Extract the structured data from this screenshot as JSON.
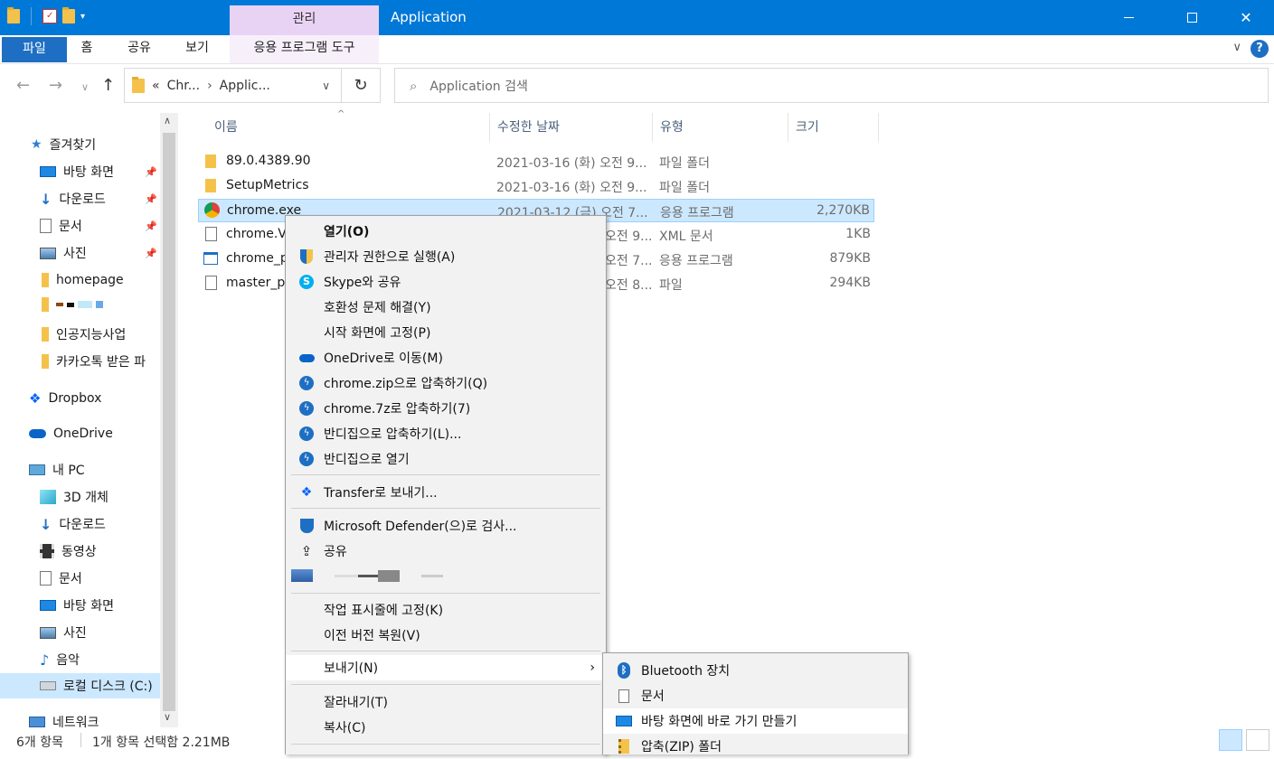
{
  "window": {
    "title": "Application",
    "context_tab_group": "관리",
    "buttons": {
      "minimize": "—",
      "maximize": "☐",
      "close": "✕"
    }
  },
  "ribbon": {
    "tabs": [
      "파일",
      "홈",
      "공유",
      "보기",
      "응용 프로그램 도구"
    ],
    "help": "?"
  },
  "address": {
    "prefix": "«",
    "crumb1": "Chr...",
    "crumb2": "Applic...",
    "search_placeholder": "Application 검색"
  },
  "sidebar": {
    "items": [
      {
        "label": "즐겨찾기",
        "icon": "star-icon"
      },
      {
        "label": "바탕 화면",
        "icon": "desktop-icon",
        "pinned": true
      },
      {
        "label": "다운로드",
        "icon": "download-icon",
        "pinned": true
      },
      {
        "label": "문서",
        "icon": "document-icon",
        "pinned": true
      },
      {
        "label": "사진",
        "icon": "pictures-icon",
        "pinned": true
      },
      {
        "label": "homepage",
        "icon": "folder-icon"
      },
      {
        "label": "",
        "icon": "folder-icon"
      },
      {
        "label": "인공지능사업",
        "icon": "folder-icon"
      },
      {
        "label": "카카오톡 받은 파",
        "icon": "folder-icon"
      },
      {
        "label": "Dropbox",
        "icon": "dropbox-icon"
      },
      {
        "label": "OneDrive",
        "icon": "onedrive-icon"
      },
      {
        "label": "내 PC",
        "icon": "pc-icon"
      },
      {
        "label": "3D 개체",
        "icon": "3d-objects-icon"
      },
      {
        "label": "다운로드",
        "icon": "download-icon"
      },
      {
        "label": "동영상",
        "icon": "video-icon"
      },
      {
        "label": "문서",
        "icon": "document-icon"
      },
      {
        "label": "바탕 화면",
        "icon": "desktop-icon"
      },
      {
        "label": "사진",
        "icon": "pictures-icon"
      },
      {
        "label": "음악",
        "icon": "music-icon"
      },
      {
        "label": "로컬 디스크 (C:)",
        "icon": "drive-icon"
      },
      {
        "label": "네트워크",
        "icon": "network-icon"
      }
    ]
  },
  "columns": {
    "name": "이름",
    "date": "수정한 날짜",
    "type": "유형",
    "size": "크기"
  },
  "files": [
    {
      "name": "89.0.4389.90",
      "date": "2021-03-16 (화) 오전 9...",
      "type": "파일 폴더",
      "size": ""
    },
    {
      "name": "SetupMetrics",
      "date": "2021-03-16 (화) 오전 9...",
      "type": "파일 폴더",
      "size": ""
    },
    {
      "name": "chrome.exe",
      "date": "2021-03-12 (금) 오전 7...",
      "type": "응용 프로그램",
      "size": "2,270KB"
    },
    {
      "name": "chrome.V",
      "date": "오전 9...",
      "type": "XML 문서",
      "size": "1KB"
    },
    {
      "name": "chrome_p",
      "date": "오전 7...",
      "type": "응용 프로그램",
      "size": "879KB"
    },
    {
      "name": "master_pr",
      "date": "오전 8...",
      "type": "파일",
      "size": "294KB"
    }
  ],
  "context_menu": {
    "items": [
      {
        "label": "열기(O)",
        "bold": true
      },
      {
        "label": "관리자 권한으로 실행(A)",
        "icon": "shield-icon"
      },
      {
        "label": "Skype와 공유",
        "icon": "skype-icon"
      },
      {
        "label": "호환성 문제 해결(Y)"
      },
      {
        "label": "시작 화면에 고정(P)"
      },
      {
        "label": "OneDrive로 이동(M)",
        "icon": "onedrive-icon"
      },
      {
        "label": "chrome.zip으로 압축하기(Q)",
        "icon": "bandizip-icon"
      },
      {
        "label": "chrome.7z로 압축하기(7)",
        "icon": "bandizip-icon"
      },
      {
        "label": "반디집으로 압축하기(L)...",
        "icon": "bandizip-icon"
      },
      {
        "label": "반디집으로 열기",
        "icon": "bandizip-icon"
      },
      {
        "label": "Transfer로 보내기...",
        "icon": "dropbox-icon"
      },
      {
        "label": "Microsoft Defender(으)로 검사...",
        "icon": "defender-icon"
      },
      {
        "label": "공유",
        "icon": "share-icon"
      },
      {
        "label": "작업 표시줄에 고정(K)"
      },
      {
        "label": "이전 버전 복원(V)"
      },
      {
        "label": "보내기(N)",
        "submenu": true
      },
      {
        "label": "잘라내기(T)"
      },
      {
        "label": "복사(C)"
      }
    ]
  },
  "submenu": {
    "items": [
      {
        "label": "Bluetooth 장치",
        "icon": "bluetooth-icon"
      },
      {
        "label": "문서",
        "icon": "document-icon"
      },
      {
        "label": "바탕 화면에 바로 가기 만들기",
        "icon": "desktop-icon"
      },
      {
        "label": "압축(ZIP) 폴더",
        "icon": "zip-folder-icon"
      }
    ]
  },
  "status": {
    "count": "6개 항목",
    "selection": "1개 항목 선택함 2.21MB"
  },
  "colors": {
    "accent": "#0078d7",
    "context_tab": "#e9d3f5",
    "selection": "#cce8ff"
  }
}
